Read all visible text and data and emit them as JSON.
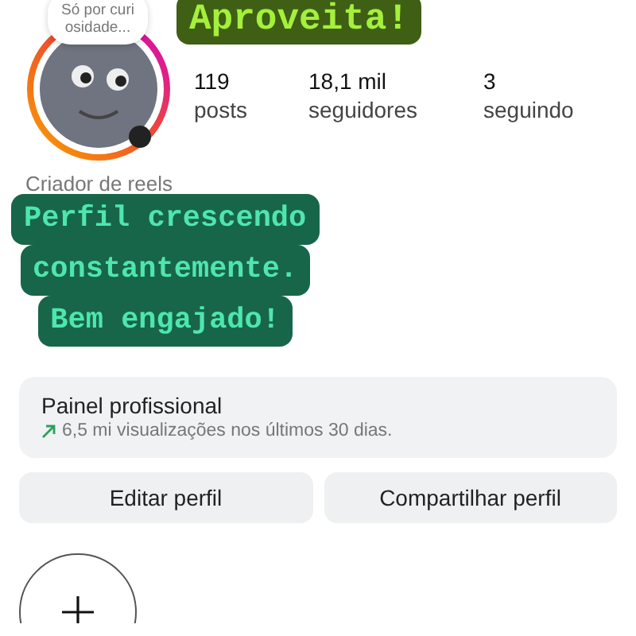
{
  "note": {
    "text": "Só por curi osidade..."
  },
  "profile": {
    "stats": [
      {
        "value": "119",
        "label": "posts"
      },
      {
        "value": "18,1 mil",
        "label": "seguidores"
      },
      {
        "value": "3",
        "label": "seguindo"
      }
    ],
    "category": "Criador de reels"
  },
  "dashboard": {
    "title": "Painel profissional",
    "subtitle": "6,5 mi visualizações nos últimos 30 dias."
  },
  "buttons": [
    "Editar perfil",
    "Compartilhar perfil"
  ],
  "stickers": [
    {
      "kind": "headline",
      "color": "#3f5f14",
      "lines": [
        "Aproveita!"
      ]
    },
    {
      "kind": "caption",
      "color": "#17664a",
      "lines": [
        "Perfil crescendo",
        "constantemente.",
        "Bem engajado!"
      ]
    }
  ]
}
